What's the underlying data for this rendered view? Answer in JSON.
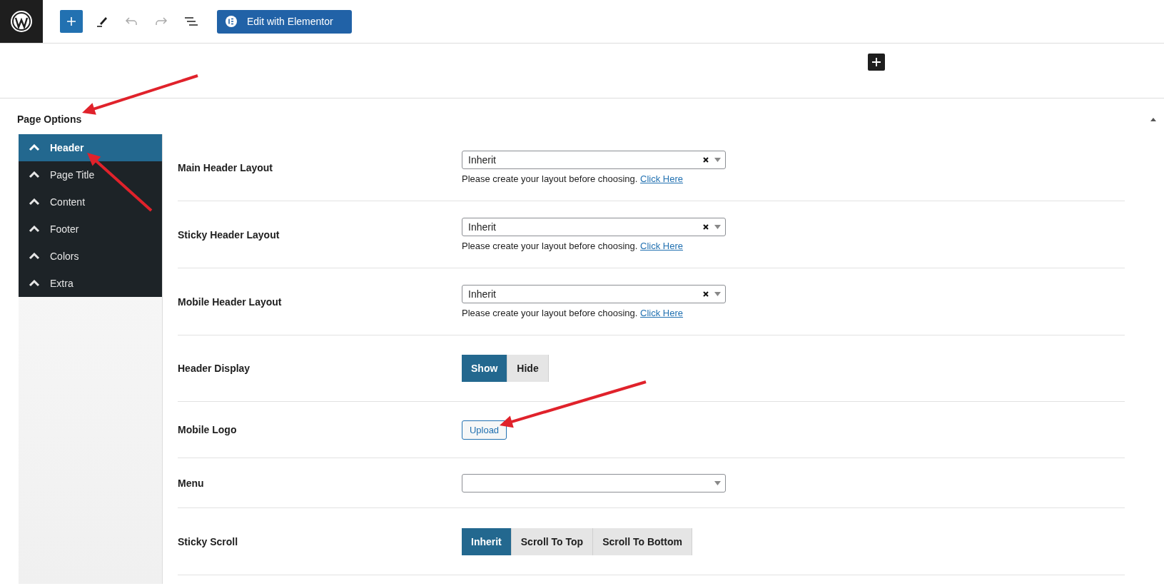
{
  "toolbar": {
    "edit_button": "Edit with Elementor"
  },
  "page_options": {
    "title": "Page Options",
    "tabs": [
      {
        "label": "Header",
        "selected": true
      },
      {
        "label": "Page Title",
        "selected": false
      },
      {
        "label": "Content",
        "selected": false
      },
      {
        "label": "Footer",
        "selected": false
      },
      {
        "label": "Colors",
        "selected": false
      },
      {
        "label": "Extra",
        "selected": false
      }
    ],
    "fields": [
      {
        "kind": "select",
        "label": "Main Header Layout",
        "value": "Inherit",
        "help": "Please create your layout before choosing.",
        "link": "Click Here"
      },
      {
        "kind": "select",
        "label": "Sticky Header Layout",
        "value": "Inherit",
        "help": "Please create your layout before choosing.",
        "link": "Click Here"
      },
      {
        "kind": "select",
        "label": "Mobile Header Layout",
        "value": "Inherit",
        "help": "Please create your layout before choosing.",
        "link": "Click Here"
      },
      {
        "kind": "toggle",
        "label": "Header Display",
        "options": [
          {
            "label": "Show",
            "selected": true
          },
          {
            "label": "Hide",
            "selected": false
          }
        ]
      },
      {
        "kind": "upload",
        "label": "Mobile Logo",
        "button": "Upload"
      },
      {
        "kind": "select",
        "label": "Menu"
      },
      {
        "kind": "toggle",
        "label": "Sticky Scroll",
        "options": [
          {
            "label": "Inherit",
            "selected": true
          },
          {
            "label": "Scroll To Top",
            "selected": false
          },
          {
            "label": "Scroll To Bottom",
            "selected": false
          }
        ]
      }
    ]
  }
}
